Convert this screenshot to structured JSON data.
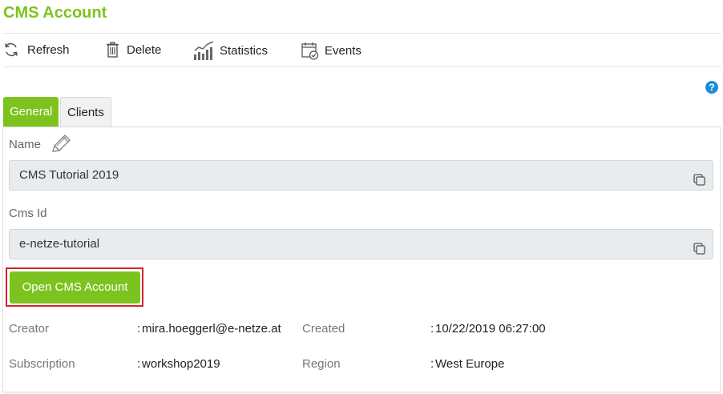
{
  "header": {
    "title": "CMS Account"
  },
  "toolbar": {
    "refresh_label": "Refresh",
    "refresh_icon": "refresh-icon",
    "delete_label": "Delete",
    "delete_icon": "trash-icon",
    "statistics_label": "Statistics",
    "statistics_icon": "chart-icon",
    "events_label": "Events",
    "events_icon": "calendar-check-icon"
  },
  "help": {
    "symbol": "?"
  },
  "tabs": [
    {
      "label": "General",
      "active": true
    },
    {
      "label": "Clients",
      "active": false
    }
  ],
  "fields": {
    "name": {
      "label": "Name",
      "value": "CMS Tutorial 2019"
    },
    "cms_id": {
      "label": "Cms Id",
      "value": "e-netze-tutorial"
    }
  },
  "actions": {
    "open_cms_label": "Open CMS Account"
  },
  "info": {
    "separator": ":",
    "creator": {
      "label": "Creator",
      "value": "mira.hoeggerl@e-netze.at"
    },
    "created": {
      "label": "Created",
      "value": "10/22/2019 06:27:00"
    },
    "subscription": {
      "label": "Subscription",
      "value": "workshop2019"
    },
    "region": {
      "label": "Region",
      "value": "West Europe"
    }
  },
  "colors": {
    "accent": "#7dc31f",
    "highlight_border": "#d9202f",
    "help": "#1c8fd8",
    "field_bg": "#e9ecee"
  }
}
